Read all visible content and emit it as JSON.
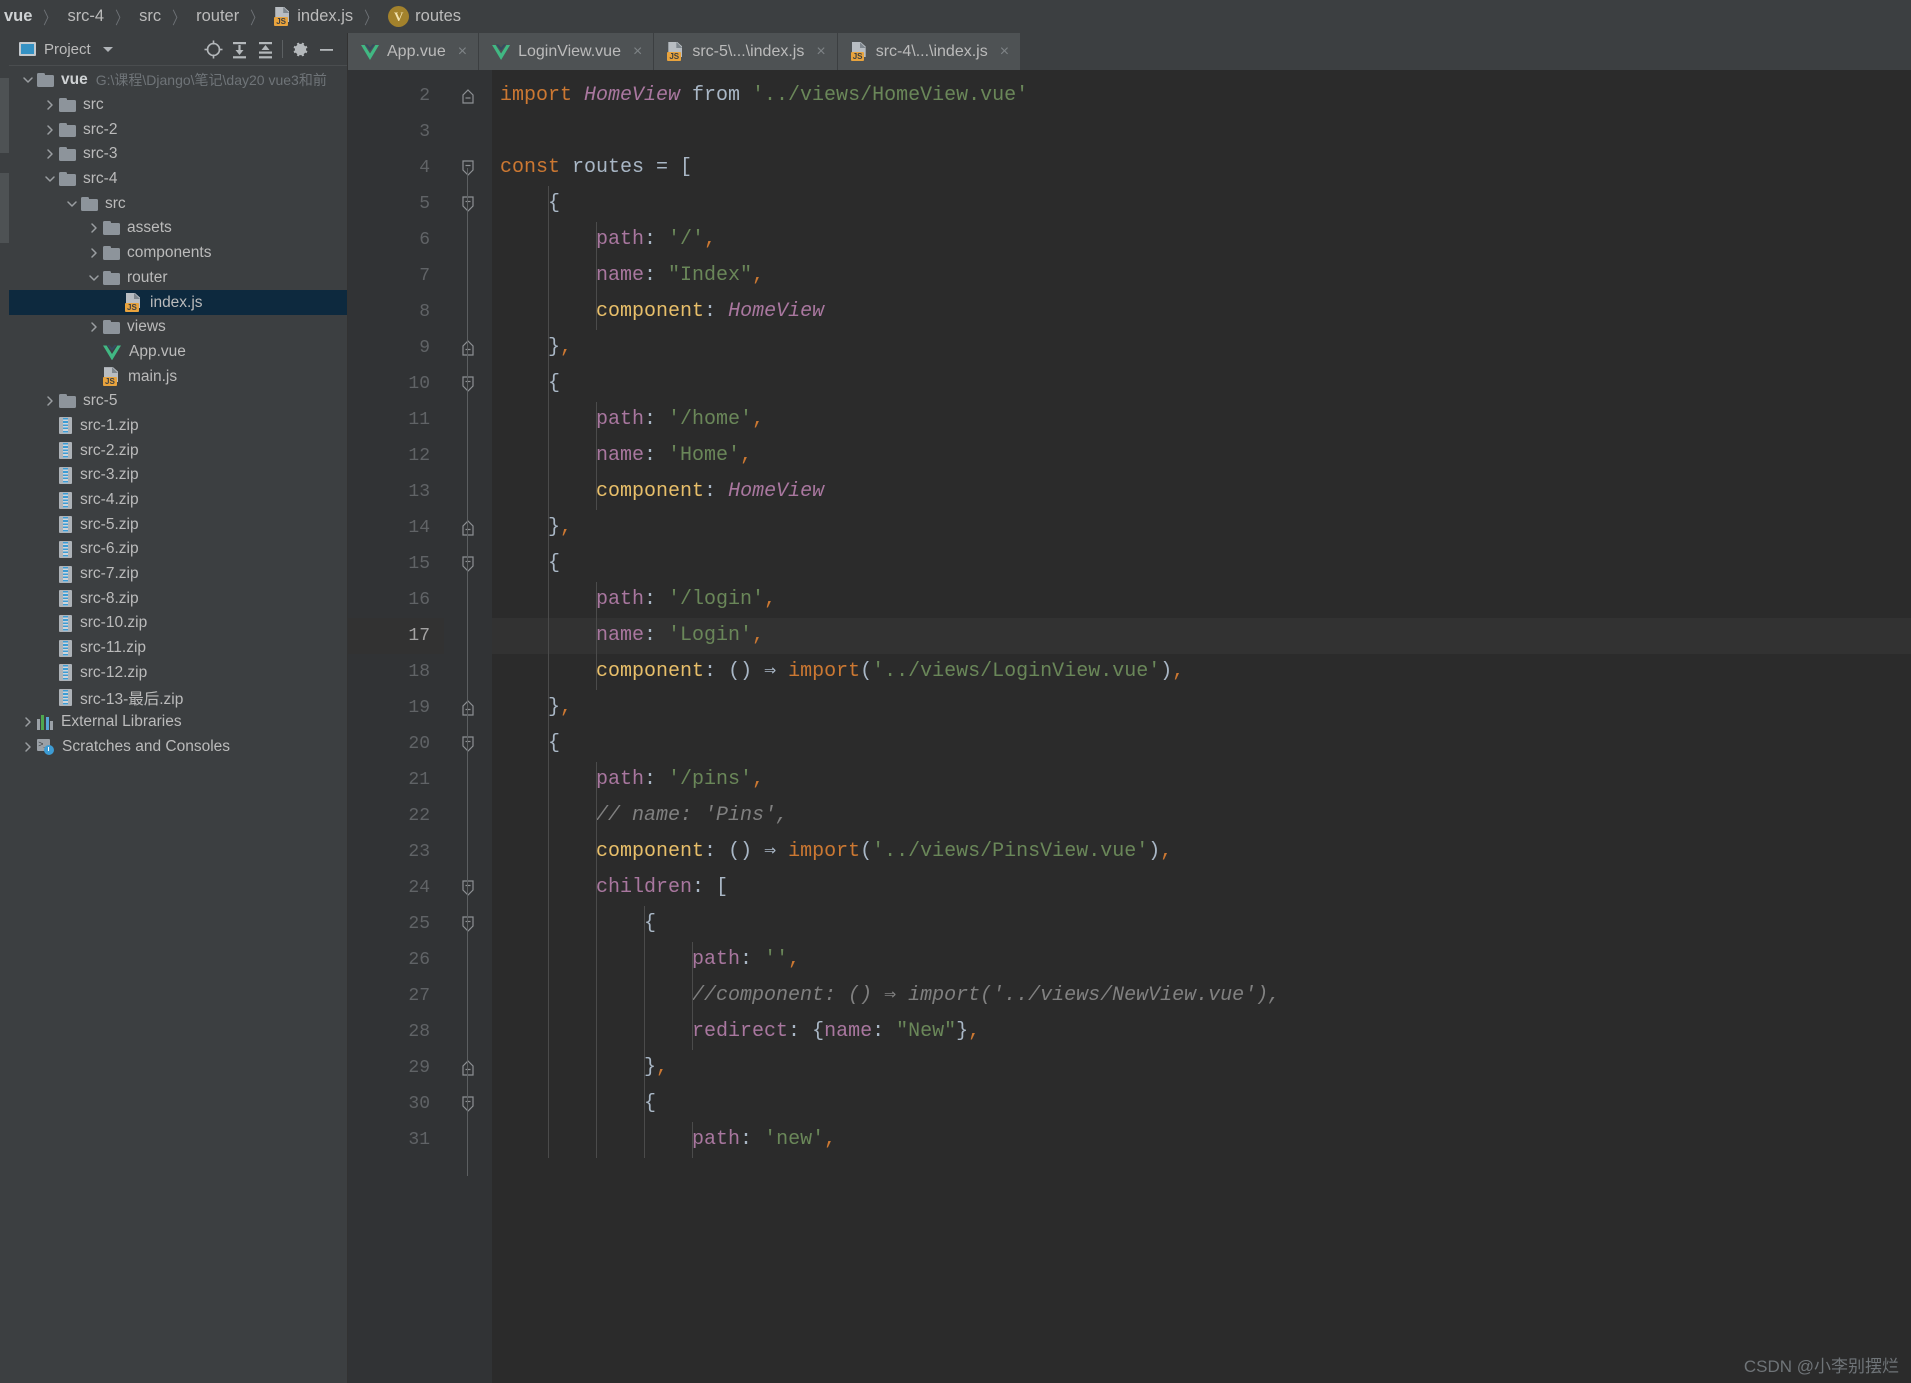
{
  "breadcrumb": {
    "items": [
      {
        "label": "vue",
        "icon": "none",
        "bold": true
      },
      {
        "label": "src-4",
        "icon": "none",
        "bold": false
      },
      {
        "label": "src",
        "icon": "none",
        "bold": false
      },
      {
        "label": "router",
        "icon": "none",
        "bold": false
      },
      {
        "label": "index.js",
        "icon": "js-file-icon",
        "bold": false
      },
      {
        "label": "routes",
        "icon": "vue-badge-icon",
        "bold": false
      }
    ],
    "separator": "〉"
  },
  "sidebar": {
    "toolbar": {
      "title": "Project",
      "dropdown_icon": "chevron-down-icon",
      "buttons": [
        {
          "name": "locate-target-icon",
          "glyph": "⊕"
        },
        {
          "name": "expand-all-icon",
          "glyph": "⤓"
        },
        {
          "name": "collapse-all-icon",
          "glyph": "⤒"
        },
        {
          "name": "settings-gear-icon",
          "glyph": "⚙"
        },
        {
          "name": "hide-panel-icon",
          "glyph": "−"
        }
      ]
    },
    "tree": [
      {
        "label": "vue",
        "path": "G:\\课程\\Django\\笔记\\day20 vue3和前",
        "indent": 0,
        "icon": "folder",
        "arrow": "down",
        "bold": true,
        "selected": false
      },
      {
        "label": "src",
        "path": "",
        "indent": 1,
        "icon": "folder",
        "arrow": "right",
        "bold": false,
        "selected": false
      },
      {
        "label": "src-2",
        "path": "",
        "indent": 1,
        "icon": "folder",
        "arrow": "right",
        "bold": false,
        "selected": false
      },
      {
        "label": "src-3",
        "path": "",
        "indent": 1,
        "icon": "folder",
        "arrow": "right",
        "bold": false,
        "selected": false
      },
      {
        "label": "src-4",
        "path": "",
        "indent": 1,
        "icon": "folder",
        "arrow": "down",
        "bold": false,
        "selected": false
      },
      {
        "label": "src",
        "path": "",
        "indent": 2,
        "icon": "folder",
        "arrow": "down",
        "bold": false,
        "selected": false
      },
      {
        "label": "assets",
        "path": "",
        "indent": 3,
        "icon": "folder",
        "arrow": "right",
        "bold": false,
        "selected": false
      },
      {
        "label": "components",
        "path": "",
        "indent": 3,
        "icon": "folder",
        "arrow": "right",
        "bold": false,
        "selected": false
      },
      {
        "label": "router",
        "path": "",
        "indent": 3,
        "icon": "folder",
        "arrow": "down",
        "bold": false,
        "selected": false
      },
      {
        "label": "index.js",
        "path": "",
        "indent": 4,
        "icon": "js-file-icon",
        "arrow": "none",
        "bold": false,
        "selected": true
      },
      {
        "label": "views",
        "path": "",
        "indent": 3,
        "icon": "folder",
        "arrow": "right",
        "bold": false,
        "selected": false
      },
      {
        "label": "App.vue",
        "path": "",
        "indent": 3,
        "icon": "vue-file-icon",
        "arrow": "none",
        "bold": false,
        "selected": false
      },
      {
        "label": "main.js",
        "path": "",
        "indent": 3,
        "icon": "js-file-icon",
        "arrow": "none",
        "bold": false,
        "selected": false
      },
      {
        "label": "src-5",
        "path": "",
        "indent": 1,
        "icon": "folder",
        "arrow": "right",
        "bold": false,
        "selected": false
      },
      {
        "label": "src-1.zip",
        "path": "",
        "indent": 1,
        "icon": "zip-file-icon",
        "arrow": "none",
        "bold": false,
        "selected": false
      },
      {
        "label": "src-2.zip",
        "path": "",
        "indent": 1,
        "icon": "zip-file-icon",
        "arrow": "none",
        "bold": false,
        "selected": false
      },
      {
        "label": "src-3.zip",
        "path": "",
        "indent": 1,
        "icon": "zip-file-icon",
        "arrow": "none",
        "bold": false,
        "selected": false
      },
      {
        "label": "src-4.zip",
        "path": "",
        "indent": 1,
        "icon": "zip-file-icon",
        "arrow": "none",
        "bold": false,
        "selected": false
      },
      {
        "label": "src-5.zip",
        "path": "",
        "indent": 1,
        "icon": "zip-file-icon",
        "arrow": "none",
        "bold": false,
        "selected": false
      },
      {
        "label": "src-6.zip",
        "path": "",
        "indent": 1,
        "icon": "zip-file-icon",
        "arrow": "none",
        "bold": false,
        "selected": false
      },
      {
        "label": "src-7.zip",
        "path": "",
        "indent": 1,
        "icon": "zip-file-icon",
        "arrow": "none",
        "bold": false,
        "selected": false
      },
      {
        "label": "src-8.zip",
        "path": "",
        "indent": 1,
        "icon": "zip-file-icon",
        "arrow": "none",
        "bold": false,
        "selected": false
      },
      {
        "label": "src-10.zip",
        "path": "",
        "indent": 1,
        "icon": "zip-file-icon",
        "arrow": "none",
        "bold": false,
        "selected": false
      },
      {
        "label": "src-11.zip",
        "path": "",
        "indent": 1,
        "icon": "zip-file-icon",
        "arrow": "none",
        "bold": false,
        "selected": false
      },
      {
        "label": "src-12.zip",
        "path": "",
        "indent": 1,
        "icon": "zip-file-icon",
        "arrow": "none",
        "bold": false,
        "selected": false
      },
      {
        "label": "src-13-最后.zip",
        "path": "",
        "indent": 1,
        "icon": "zip-file-icon",
        "arrow": "none",
        "bold": false,
        "selected": false
      },
      {
        "label": "External Libraries",
        "path": "",
        "indent": 0,
        "icon": "external-libraries-icon",
        "arrow": "right",
        "bold": false,
        "selected": false
      },
      {
        "label": "Scratches and Consoles",
        "path": "",
        "indent": 0,
        "icon": "scratches-icon",
        "arrow": "right",
        "bold": false,
        "selected": false
      }
    ]
  },
  "editor": {
    "tabs": [
      {
        "label": "App.vue",
        "icon": "vue-file-icon",
        "active": false,
        "close": "×"
      },
      {
        "label": "LoginView.vue",
        "icon": "vue-file-icon",
        "active": false,
        "close": "×"
      },
      {
        "label": "src-5\\...\\index.js",
        "icon": "js-file-icon",
        "active": false,
        "close": "×"
      },
      {
        "label": "src-4\\...\\index.js",
        "icon": "js-file-icon",
        "active": true,
        "close": "×"
      }
    ],
    "current_line": 17,
    "lines": [
      {
        "n": 2,
        "indent": 0,
        "fold": "start-top",
        "tokens": [
          [
            "kw",
            "import "
          ],
          [
            "cls",
            "HomeView"
          ],
          [
            "plain",
            " from "
          ],
          [
            "str",
            "'../views/HomeView.vue'"
          ]
        ]
      },
      {
        "n": 3,
        "indent": 0,
        "fold": "none",
        "tokens": [
          [
            "plain",
            ""
          ]
        ]
      },
      {
        "n": 4,
        "indent": 0,
        "fold": "open",
        "tokens": [
          [
            "kw",
            "const "
          ],
          [
            "ident",
            "routes "
          ],
          [
            "plain",
            "= "
          ],
          [
            "brace",
            "["
          ]
        ]
      },
      {
        "n": 5,
        "indent": 1,
        "fold": "open",
        "tokens": [
          [
            "plain",
            "    "
          ],
          [
            "brace",
            "{"
          ]
        ]
      },
      {
        "n": 6,
        "indent": 2,
        "fold": "none",
        "tokens": [
          [
            "plain",
            "        "
          ],
          [
            "prop",
            "path"
          ],
          [
            "plain",
            ": "
          ],
          [
            "str",
            "'/'"
          ],
          [
            "comma",
            ","
          ]
        ]
      },
      {
        "n": 7,
        "indent": 2,
        "fold": "none",
        "tokens": [
          [
            "plain",
            "        "
          ],
          [
            "prop",
            "name"
          ],
          [
            "plain",
            ": "
          ],
          [
            "str",
            "\"Index\""
          ],
          [
            "comma",
            ","
          ]
        ]
      },
      {
        "n": 8,
        "indent": 2,
        "fold": "none",
        "tokens": [
          [
            "plain",
            "        "
          ],
          [
            "propo",
            "component"
          ],
          [
            "plain",
            ": "
          ],
          [
            "cls",
            "HomeView"
          ]
        ]
      },
      {
        "n": 9,
        "indent": 1,
        "fold": "close",
        "tokens": [
          [
            "plain",
            "    "
          ],
          [
            "brace",
            "}"
          ],
          [
            "comma",
            ","
          ]
        ]
      },
      {
        "n": 10,
        "indent": 1,
        "fold": "open",
        "tokens": [
          [
            "plain",
            "    "
          ],
          [
            "brace",
            "{"
          ]
        ]
      },
      {
        "n": 11,
        "indent": 2,
        "fold": "none",
        "tokens": [
          [
            "plain",
            "        "
          ],
          [
            "prop",
            "path"
          ],
          [
            "plain",
            ": "
          ],
          [
            "str",
            "'/home'"
          ],
          [
            "comma",
            ","
          ]
        ]
      },
      {
        "n": 12,
        "indent": 2,
        "fold": "none",
        "tokens": [
          [
            "plain",
            "        "
          ],
          [
            "prop",
            "name"
          ],
          [
            "plain",
            ": "
          ],
          [
            "str",
            "'Home'"
          ],
          [
            "comma",
            ","
          ]
        ]
      },
      {
        "n": 13,
        "indent": 2,
        "fold": "none",
        "tokens": [
          [
            "plain",
            "        "
          ],
          [
            "propo",
            "component"
          ],
          [
            "plain",
            ": "
          ],
          [
            "cls",
            "HomeView"
          ]
        ]
      },
      {
        "n": 14,
        "indent": 1,
        "fold": "close",
        "tokens": [
          [
            "plain",
            "    "
          ],
          [
            "brace",
            "}"
          ],
          [
            "comma",
            ","
          ]
        ]
      },
      {
        "n": 15,
        "indent": 1,
        "fold": "open",
        "tokens": [
          [
            "plain",
            "    "
          ],
          [
            "brace",
            "{"
          ]
        ]
      },
      {
        "n": 16,
        "indent": 2,
        "fold": "none",
        "tokens": [
          [
            "plain",
            "        "
          ],
          [
            "prop",
            "path"
          ],
          [
            "plain",
            ": "
          ],
          [
            "str",
            "'/login'"
          ],
          [
            "comma",
            ","
          ]
        ]
      },
      {
        "n": 17,
        "indent": 2,
        "fold": "none",
        "tokens": [
          [
            "plain",
            "        "
          ],
          [
            "prop",
            "name"
          ],
          [
            "plain",
            ": "
          ],
          [
            "str",
            "'Login'"
          ],
          [
            "comma",
            ","
          ]
        ]
      },
      {
        "n": 18,
        "indent": 2,
        "fold": "none",
        "tokens": [
          [
            "plain",
            "        "
          ],
          [
            "propo",
            "component"
          ],
          [
            "plain",
            ": "
          ],
          [
            "paren",
            "() "
          ],
          [
            "plain",
            "⇒ "
          ],
          [
            "func",
            "import"
          ],
          [
            "paren",
            "("
          ],
          [
            "str",
            "'../views/LoginView.vue'"
          ],
          [
            "paren",
            ")"
          ],
          [
            "comma",
            ","
          ]
        ]
      },
      {
        "n": 19,
        "indent": 1,
        "fold": "close",
        "tokens": [
          [
            "plain",
            "    "
          ],
          [
            "brace",
            "}"
          ],
          [
            "comma",
            ","
          ]
        ]
      },
      {
        "n": 20,
        "indent": 1,
        "fold": "open",
        "tokens": [
          [
            "plain",
            "    "
          ],
          [
            "brace",
            "{"
          ]
        ]
      },
      {
        "n": 21,
        "indent": 2,
        "fold": "none",
        "tokens": [
          [
            "plain",
            "        "
          ],
          [
            "prop",
            "path"
          ],
          [
            "plain",
            ": "
          ],
          [
            "str",
            "'/pins'"
          ],
          [
            "comma",
            ","
          ]
        ]
      },
      {
        "n": 22,
        "indent": 2,
        "fold": "none",
        "tokens": [
          [
            "plain",
            "        "
          ],
          [
            "cmt",
            "// name: 'Pins',"
          ]
        ]
      },
      {
        "n": 23,
        "indent": 2,
        "fold": "none",
        "tokens": [
          [
            "plain",
            "        "
          ],
          [
            "propo",
            "component"
          ],
          [
            "plain",
            ": "
          ],
          [
            "paren",
            "() "
          ],
          [
            "plain",
            "⇒ "
          ],
          [
            "func",
            "import"
          ],
          [
            "paren",
            "("
          ],
          [
            "str",
            "'../views/PinsView.vue'"
          ],
          [
            "paren",
            ")"
          ],
          [
            "comma",
            ","
          ]
        ]
      },
      {
        "n": 24,
        "indent": 2,
        "fold": "open",
        "tokens": [
          [
            "plain",
            "        "
          ],
          [
            "prop",
            "children"
          ],
          [
            "plain",
            ": "
          ],
          [
            "brace",
            "["
          ]
        ]
      },
      {
        "n": 25,
        "indent": 3,
        "fold": "open",
        "tokens": [
          [
            "plain",
            "            "
          ],
          [
            "brace",
            "{"
          ]
        ]
      },
      {
        "n": 26,
        "indent": 4,
        "fold": "none",
        "tokens": [
          [
            "plain",
            "                "
          ],
          [
            "prop",
            "path"
          ],
          [
            "plain",
            ": "
          ],
          [
            "str",
            "''"
          ],
          [
            "comma",
            ","
          ]
        ]
      },
      {
        "n": 27,
        "indent": 4,
        "fold": "none",
        "tokens": [
          [
            "plain",
            "                "
          ],
          [
            "cmt",
            "//component: () ⇒ import('../views/NewView.vue'),"
          ]
        ]
      },
      {
        "n": 28,
        "indent": 4,
        "fold": "none",
        "tokens": [
          [
            "plain",
            "                "
          ],
          [
            "prop",
            "redirect"
          ],
          [
            "plain",
            ": "
          ],
          [
            "brace",
            "{"
          ],
          [
            "prop",
            "name"
          ],
          [
            "plain",
            ": "
          ],
          [
            "str",
            "\"New\""
          ],
          [
            "brace",
            "}"
          ],
          [
            "comma",
            ","
          ]
        ]
      },
      {
        "n": 29,
        "indent": 3,
        "fold": "close",
        "tokens": [
          [
            "plain",
            "            "
          ],
          [
            "brace",
            "}"
          ],
          [
            "comma",
            ","
          ]
        ]
      },
      {
        "n": 30,
        "indent": 3,
        "fold": "open",
        "tokens": [
          [
            "plain",
            "            "
          ],
          [
            "brace",
            "{"
          ]
        ]
      },
      {
        "n": 31,
        "indent": 4,
        "fold": "none",
        "tokens": [
          [
            "plain",
            "                "
          ],
          [
            "prop",
            "path"
          ],
          [
            "plain",
            ": "
          ],
          [
            "str",
            "'new'"
          ],
          [
            "comma",
            ","
          ]
        ]
      }
    ]
  },
  "watermark": "CSDN @小李别摆烂"
}
